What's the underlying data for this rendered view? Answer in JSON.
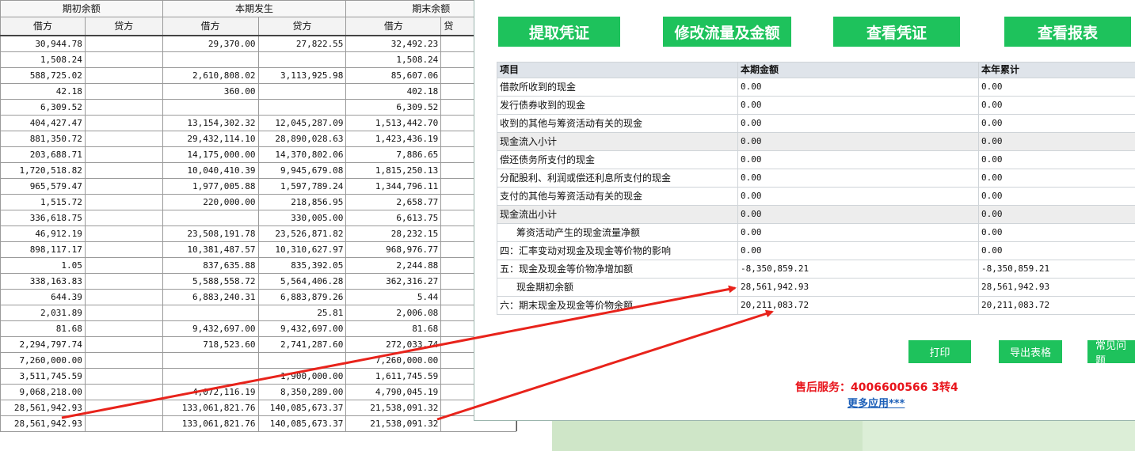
{
  "ledger": {
    "header_groups": [
      "期初余额",
      "本期发生",
      "期末余额"
    ],
    "sub_headers": [
      "借方",
      "贷方",
      "借方",
      "贷方",
      "借方",
      "贷"
    ],
    "rows": [
      [
        "30,944.78",
        "",
        "29,370.00",
        "27,822.55",
        "32,492.23",
        ""
      ],
      [
        "1,508.24",
        "",
        "",
        "",
        "1,508.24",
        ""
      ],
      [
        "588,725.02",
        "",
        "2,610,808.02",
        "3,113,925.98",
        "85,607.06",
        ""
      ],
      [
        "42.18",
        "",
        "360.00",
        "",
        "402.18",
        ""
      ],
      [
        "6,309.52",
        "",
        "",
        "",
        "6,309.52",
        ""
      ],
      [
        "404,427.47",
        "",
        "13,154,302.32",
        "12,045,287.09",
        "1,513,442.70",
        ""
      ],
      [
        "881,350.72",
        "",
        "29,432,114.10",
        "28,890,028.63",
        "1,423,436.19",
        ""
      ],
      [
        "203,688.71",
        "",
        "14,175,000.00",
        "14,370,802.06",
        "7,886.65",
        ""
      ],
      [
        "1,720,518.82",
        "",
        "10,040,410.39",
        "9,945,679.08",
        "1,815,250.13",
        ""
      ],
      [
        "965,579.47",
        "",
        "1,977,005.88",
        "1,597,789.24",
        "1,344,796.11",
        ""
      ],
      [
        "1,515.72",
        "",
        "220,000.00",
        "218,856.95",
        "2,658.77",
        ""
      ],
      [
        "336,618.75",
        "",
        "",
        "330,005.00",
        "6,613.75",
        ""
      ],
      [
        "46,912.19",
        "",
        "23,508,191.78",
        "23,526,871.82",
        "28,232.15",
        ""
      ],
      [
        "898,117.17",
        "",
        "10,381,487.57",
        "10,310,627.97",
        "968,976.77",
        ""
      ],
      [
        "1.05",
        "",
        "837,635.88",
        "835,392.05",
        "2,244.88",
        ""
      ],
      [
        "338,163.83",
        "",
        "5,588,558.72",
        "5,564,406.28",
        "362,316.27",
        ""
      ],
      [
        "644.39",
        "",
        "6,883,240.31",
        "6,883,879.26",
        "5.44",
        ""
      ],
      [
        "2,031.89",
        "",
        "",
        "25.81",
        "2,006.08",
        ""
      ],
      [
        "81.68",
        "",
        "9,432,697.00",
        "9,432,697.00",
        "81.68",
        ""
      ],
      [
        "2,294,797.74",
        "",
        "718,523.60",
        "2,741,287.60",
        "272,033.74",
        ""
      ],
      [
        "7,260,000.00",
        "",
        "",
        "",
        "7,260,000.00",
        ""
      ],
      [
        "3,511,745.59",
        "",
        "",
        "1,900,000.00",
        "1,611,745.59",
        ""
      ],
      [
        "9,068,218.00",
        "",
        "4,072,116.19",
        "8,350,289.00",
        "4,790,045.19",
        ""
      ],
      [
        "28,561,942.93",
        "",
        "133,061,821.76",
        "140,085,673.37",
        "21,538,091.32",
        ""
      ],
      [
        "28,561,942.93",
        "",
        "133,061,821.76",
        "140,085,673.37",
        "21,538,091.32",
        ""
      ]
    ]
  },
  "toolbar": {
    "extract": "提取凭证",
    "modify": "修改流量及金额",
    "view_voucher": "查看凭证",
    "view_report": "查看报表"
  },
  "cashflow": {
    "columns": [
      "项目",
      "本期金额",
      "本年累计"
    ],
    "rows": [
      {
        "item": "借款所收到的现金",
        "current": "0.00",
        "ytd": "0.00"
      },
      {
        "item": "发行债券收到的现金",
        "current": "0.00",
        "ytd": "0.00"
      },
      {
        "item": "收到的其他与筹资活动有关的现金",
        "current": "0.00",
        "ytd": "0.00"
      },
      {
        "item": "现金流入小计",
        "current": "0.00",
        "ytd": "0.00"
      },
      {
        "item": "偿还债务所支付的现金",
        "current": "0.00",
        "ytd": "0.00"
      },
      {
        "item": "分配股利、利润或偿还利息所支付的现金",
        "current": "0.00",
        "ytd": "0.00"
      },
      {
        "item": "支付的其他与筹资活动有关的现金",
        "current": "0.00",
        "ytd": "0.00"
      },
      {
        "item": "现金流出小计",
        "current": "0.00",
        "ytd": "0.00"
      },
      {
        "item": "筹资活动产生的现金流量净额",
        "current": "0.00",
        "ytd": "0.00"
      },
      {
        "item": "四：汇率变动对现金及现金等价物的影响",
        "current": "0.00",
        "ytd": "0.00"
      },
      {
        "item": "五：现金及现金等价物净增加额",
        "current": "-8,350,859.21",
        "ytd": "-8,350,859.21"
      },
      {
        "item": "现金期初余额",
        "current": "28,561,942.93",
        "ytd": "28,561,942.93"
      },
      {
        "item": "六：期末现金及现金等价物余额",
        "current": "20,211,083.72",
        "ytd": "20,211,083.72"
      }
    ]
  },
  "actions": {
    "print": "打印",
    "export": "导出表格",
    "faq": "常见问题"
  },
  "service": "售后服务：4006600566 3转4",
  "more_apps": "更多应用***",
  "colors": {
    "button_green": "#1ec25c",
    "service_red": "#e8141b",
    "link_blue": "#1c5fb8",
    "arrow_red": "#e8231b"
  }
}
